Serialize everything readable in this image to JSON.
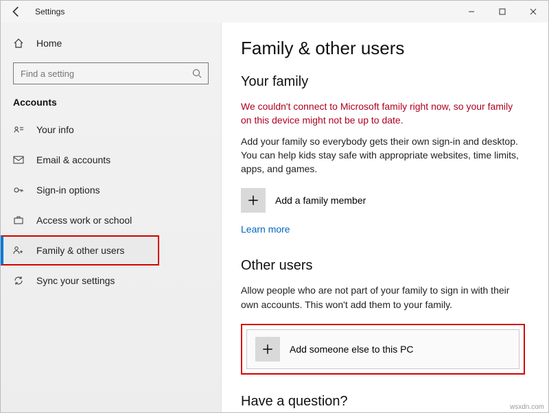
{
  "titlebar": {
    "title": "Settings"
  },
  "sidebar": {
    "home_label": "Home",
    "search_placeholder": "Find a setting",
    "category": "Accounts",
    "items": [
      {
        "label": "Your info"
      },
      {
        "label": "Email & accounts"
      },
      {
        "label": "Sign-in options"
      },
      {
        "label": "Access work or school"
      },
      {
        "label": "Family & other users"
      },
      {
        "label": "Sync your settings"
      }
    ]
  },
  "main": {
    "heading": "Family & other users",
    "family_heading": "Your family",
    "family_error": "We couldn't connect to Microsoft family right now, so your family on this device might not be up to date.",
    "family_desc": "Add your family so everybody gets their own sign-in and desktop. You can help kids stay safe with appropriate websites, time limits, apps, and games.",
    "add_family_label": "Add a family member",
    "learn_more": "Learn more",
    "other_heading": "Other users",
    "other_desc": "Allow people who are not part of your family to sign in with their own accounts. This won't add them to your family.",
    "add_other_label": "Add someone else to this PC",
    "question_heading": "Have a question?"
  },
  "footer": {
    "credit": "wsxdn.com"
  }
}
